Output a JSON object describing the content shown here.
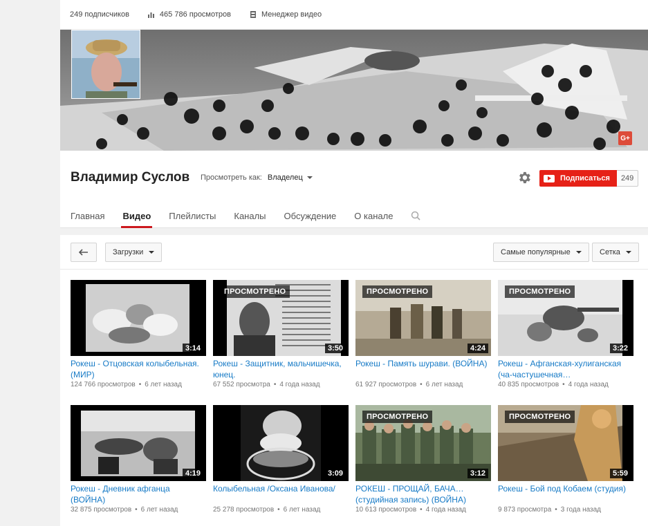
{
  "stats": {
    "subscribers": "249 подписчиков",
    "views": "465 786 просмотров",
    "video_manager": "Менеджер видео"
  },
  "channel": {
    "name": "Владимир Суслов",
    "view_as_label": "Просмотреть как:",
    "view_as_value": "Владелец",
    "subscribe_label": "Подписаться",
    "subscribe_count": "249",
    "gplus": "G+"
  },
  "tabs": [
    "Главная",
    "Видео",
    "Плейлисты",
    "Каналы",
    "Обсуждение",
    "О канале"
  ],
  "active_tab": "Видео",
  "toolbar": {
    "uploads": "Загрузки",
    "sort": "Самые популярные",
    "view": "Сетка"
  },
  "colors": {
    "accent": "#cc181e",
    "subscribe": "#e62117",
    "link": "#167ac6"
  },
  "videos": [
    {
      "title": "Рокеш - Отцовская колыбельная. (МИР)",
      "views": "124 766 просмотров",
      "age": "6 лет назад",
      "duration": "3:14",
      "watched": ""
    },
    {
      "title": "Рокеш - Защитник, мальчишечка, юнец.",
      "views": "67 552 просмотра",
      "age": "4 года назад",
      "duration": "3:50",
      "watched": "ПРОСМОТРЕНО"
    },
    {
      "title": "Рокеш - Память шурави. (ВОЙНА)",
      "views": "61 927 просмотров",
      "age": "6 лет назад",
      "duration": "4:24",
      "watched": "ПРОСМОТРЕНО"
    },
    {
      "title": "Рокеш - Афганская-хулиганская (ча-частушечная…",
      "views": "40 835 просмотров",
      "age": "4 года назад",
      "duration": "3:22",
      "watched": "ПРОСМОТРЕНО"
    },
    {
      "title": "Рокеш - Дневник афганца (ВОЙНА)",
      "views": "32 875 просмотров",
      "age": "6 лет назад",
      "duration": "4:19",
      "watched": ""
    },
    {
      "title": "Колыбельная /Оксана Иванова/",
      "views": "25 278 просмотров",
      "age": "6 лет назад",
      "duration": "3:09",
      "watched": ""
    },
    {
      "title": "РОКЕШ - ПРОЩАЙ, БАЧА… (студийная запись) (ВОЙНА)",
      "views": "10 613 просмотров",
      "age": "4 года назад",
      "duration": "3:12",
      "watched": "ПРОСМОТРЕНО"
    },
    {
      "title": "Рокеш - Бой под Кобаем (студия)",
      "views": "9 873 просмотра",
      "age": "3 года назад",
      "duration": "5:59",
      "watched": "ПРОСМОТРЕНО"
    }
  ]
}
